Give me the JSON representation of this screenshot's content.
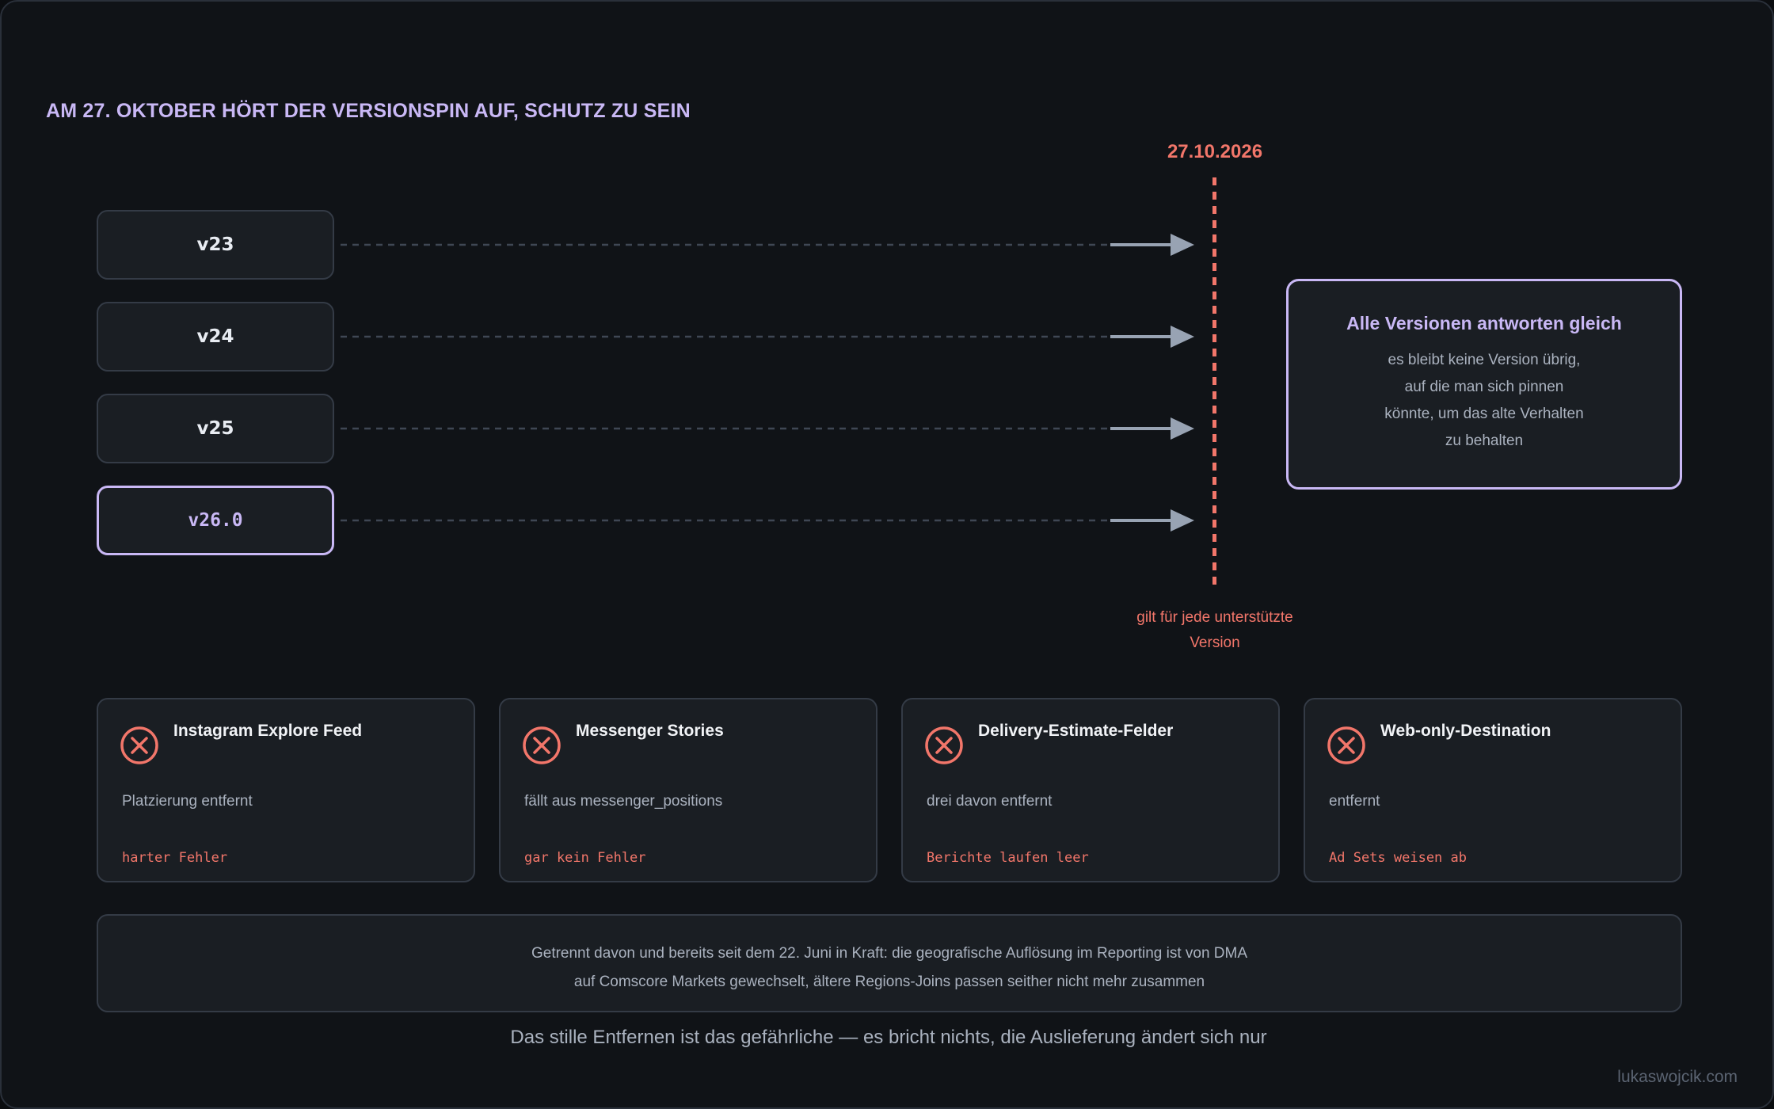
{
  "headline": "AM 27. OKTOBER HÖRT DER VERSIONSPIN AUF, SCHUTZ ZU SEIN",
  "deadline": {
    "date": "27.10.2026",
    "note_line1": "gilt für jede unterstützte",
    "note_line2": "Version"
  },
  "versions": [
    {
      "label": "v23",
      "current": false
    },
    {
      "label": "v24",
      "current": false
    },
    {
      "label": "v25",
      "current": false
    },
    {
      "label": "v26.0",
      "current": true
    }
  ],
  "callout": {
    "title": "Alle Versionen antworten gleich",
    "lines": [
      "es bleibt keine Version übrig,",
      "auf die man sich pinnen",
      "könnte, um das alte Verhalten",
      "zu behalten"
    ]
  },
  "cards": [
    {
      "icon": "x-circle-icon",
      "title": "Instagram Explore Feed",
      "description": "Platzierung entfernt",
      "impact": "harter Fehler"
    },
    {
      "icon": "x-circle-icon",
      "title": "Messenger Stories",
      "description": "fällt aus messenger_positions",
      "impact": "gar kein Fehler"
    },
    {
      "icon": "x-circle-icon",
      "title": "Delivery-Estimate-Felder",
      "description": "drei davon entfernt",
      "impact": "Berichte laufen leer"
    },
    {
      "icon": "x-circle-icon",
      "title": "Web-only-Destination",
      "description": "entfernt",
      "impact": "Ad Sets weisen ab"
    }
  ],
  "note": {
    "line1": "Getrennt davon und bereits seit dem 22. Juni in Kraft: die geografische Auflösung im Reporting ist von DMA",
    "line2": "auf Comscore Markets gewechselt, ältere Regions-Joins passen seither nicht mehr zusammen"
  },
  "summary": "Das stille Entfernen ist das gefährliche — es bricht nichts, die Auslieferung ändert sich nur",
  "watermark": "lukaswojcik.com",
  "colors": {
    "accent": "#c9b8f5",
    "danger": "#f2766a",
    "background": "#101317",
    "card": "#1a1e23"
  }
}
